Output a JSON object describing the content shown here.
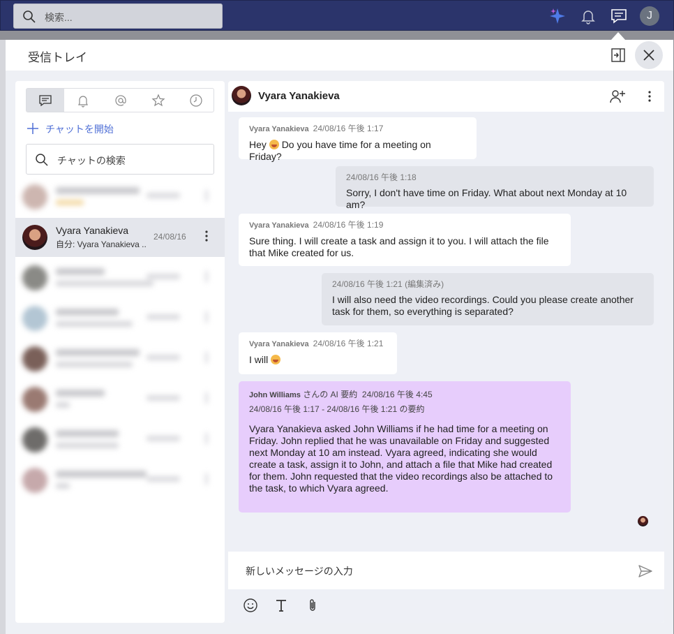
{
  "topbar": {
    "search_placeholder": "検索...",
    "user_initial": "J",
    "icons": [
      "copilot-sparkle-icon",
      "bell-icon",
      "message-icon"
    ]
  },
  "panel": {
    "title": "受信トレイ"
  },
  "chatlist": {
    "tabs": [
      "chat-icon",
      "bell-icon",
      "at-icon",
      "star-icon",
      "clock-icon"
    ],
    "start_chat": "チャットを開始",
    "search_placeholder": "チャットの検索",
    "active_chat": {
      "name": "Vyara Yanakieva",
      "preview": "自分: Vyara Yanakieva ...",
      "date": "24/08/16"
    }
  },
  "conversation": {
    "contact_name": "Vyara Yanakieva",
    "messages": [
      {
        "author": "Vyara Yanakieva",
        "time": "24/08/16 午後 1:17",
        "text_before": "Hey",
        "text_after": "Do you have time for a meeting on Friday?"
      },
      {
        "time": "24/08/16 午後 1:18",
        "text": "Sorry, I don't have time on Friday. What about next Monday at 10 am?"
      },
      {
        "author": "Vyara Yanakieva",
        "time": "24/08/16 午後 1:19",
        "text": "Sure thing. I will create a task and assign it to you. I will attach the file that Mike created for us."
      },
      {
        "time": "24/08/16 午後 1:21 (編集済み)",
        "text": "I will also need the video recordings. Could you please create another task for them, so everything is separated?"
      },
      {
        "author": "Vyara Yanakieva",
        "time": "24/08/16 午後 1:21",
        "text": "I will"
      }
    ],
    "summary": {
      "author": "John Williams",
      "label": "さんの AI 要約",
      "time": "24/08/16 午後 4:45",
      "range": "24/08/16 午後 1:17 - 24/08/16 午後 1:21 の要約",
      "text": "Vyara Yanakieva asked John Williams if he had time for a meeting on Friday. John replied that he was unavailable on Friday and suggested next Monday at 10 am instead. Vyara agreed, indicating she would create a task, assign it to John, and attach a file that Mike had created for them. John requested that the video recordings also be attached to the task, to which Vyara agreed."
    },
    "composer_placeholder": "新しいメッセージの入力"
  },
  "colors": {
    "topbar": "#2b346b",
    "accent": "#4f6fd6",
    "summary_bg": "#e7cdfc"
  }
}
